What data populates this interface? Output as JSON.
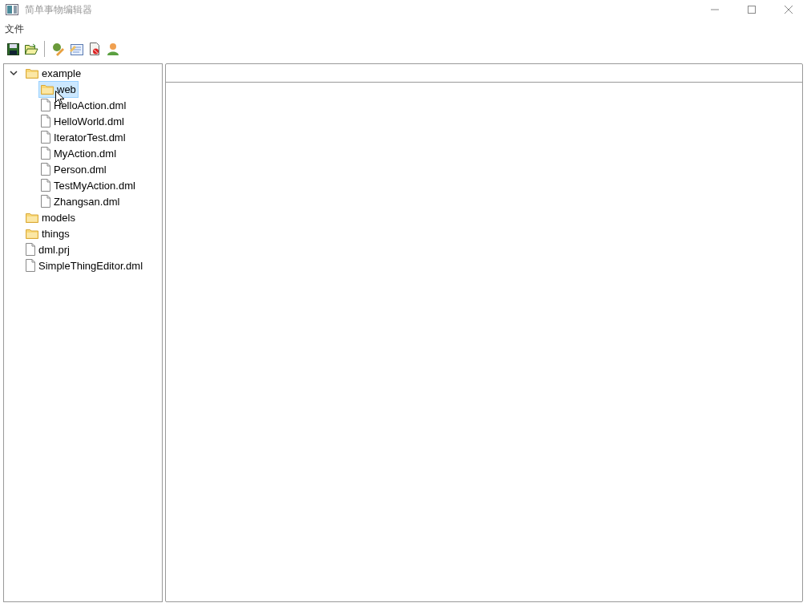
{
  "window": {
    "title": "简单事物编辑器"
  },
  "menu": [
    "文件"
  ],
  "tree": [
    {
      "label": "example",
      "kind": "folder",
      "selected": false,
      "expanded": true,
      "children": [
        {
          "label": "web",
          "kind": "folder",
          "selected": true
        },
        {
          "label": "HelloAction.dml",
          "kind": "file",
          "selected": false
        },
        {
          "label": "HelloWorld.dml",
          "kind": "file",
          "selected": false
        },
        {
          "label": "IteratorTest.dml",
          "kind": "file",
          "selected": false
        },
        {
          "label": "MyAction.dml",
          "kind": "file",
          "selected": false
        },
        {
          "label": "Person.dml",
          "kind": "file",
          "selected": false
        },
        {
          "label": "TestMyAction.dml",
          "kind": "file",
          "selected": false
        },
        {
          "label": "Zhangsan.dml",
          "kind": "file",
          "selected": false
        }
      ]
    },
    {
      "label": "models",
      "kind": "folder",
      "selected": false
    },
    {
      "label": "things",
      "kind": "folder",
      "selected": false
    },
    {
      "label": "dml.prj",
      "kind": "file",
      "selected": false
    },
    {
      "label": "SimpleThingEditor.dml",
      "kind": "file",
      "selected": false
    }
  ]
}
